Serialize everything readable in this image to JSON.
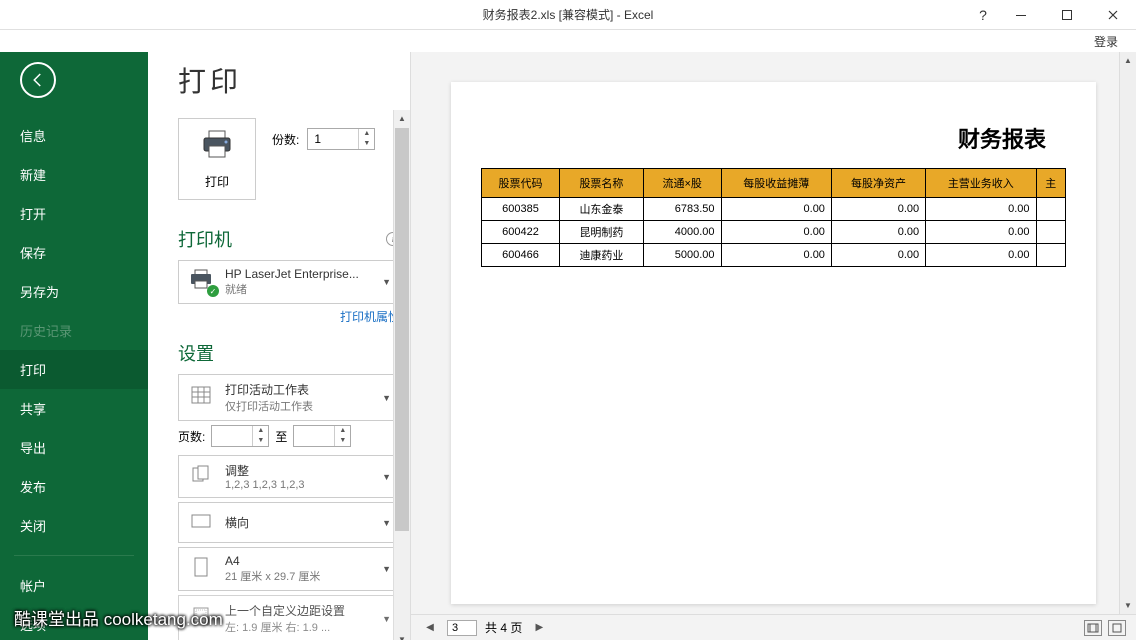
{
  "window": {
    "title": "财务报表2.xls  [兼容模式] - Excel",
    "help": "?",
    "login": "登录"
  },
  "sidebar": {
    "items": [
      "信息",
      "新建",
      "打开",
      "保存",
      "另存为",
      "历史记录",
      "打印",
      "共享",
      "导出",
      "发布",
      "关闭"
    ],
    "bottom": [
      "帐户",
      "选项"
    ]
  },
  "print": {
    "title": "打印",
    "button": "打印",
    "copies_label": "份数:",
    "copies_value": "1"
  },
  "printer": {
    "section": "打印机",
    "name": "HP LaserJet Enterprise...",
    "status": "就绪",
    "properties": "打印机属性"
  },
  "settings": {
    "section": "设置",
    "active_sheet": {
      "main": "打印活动工作表",
      "sub": "仅打印活动工作表"
    },
    "pages_label": "页数:",
    "to_label": "至",
    "collate": {
      "main": "调整",
      "sub": "1,2,3    1,2,3    1,2,3"
    },
    "orientation": {
      "main": "横向",
      "sub": ""
    },
    "paper": {
      "main": "A4",
      "sub": "21 厘米 x 29.7 厘米"
    },
    "margins": {
      "main": "上一个自定义边距设置",
      "sub": "左: 1.9 厘米    右: 1.9 ..."
    }
  },
  "preview": {
    "report_title": "财务报表",
    "headers": [
      "股票代码",
      "股票名称",
      "流通×股",
      "每股收益摊薄",
      "每股净资产",
      "主营业务收入",
      "主"
    ],
    "rows": [
      [
        "600385",
        "山东金泰",
        "6783.50",
        "0.00",
        "0.00",
        "0.00"
      ],
      [
        "600422",
        "昆明制药",
        "4000.00",
        "0.00",
        "0.00",
        "0.00"
      ],
      [
        "600466",
        "迪康药业",
        "5000.00",
        "0.00",
        "0.00",
        "0.00"
      ]
    ],
    "page_current": "3",
    "page_total": "共 4 页"
  },
  "watermark": "酷课堂出品 coolketang.com"
}
